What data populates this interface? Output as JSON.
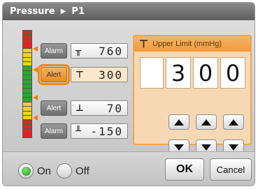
{
  "titlebar": {
    "title": "Pressure",
    "separator_icon": "triangle-right-icon",
    "channel": "P1"
  },
  "level_bar": {
    "segments": [
      "#d42b1e",
      "#d42b1e",
      "#d42b1e",
      "#d42b1e",
      "#f0d21a",
      "#f0d21a",
      "#f0d21a",
      "#f0d21a",
      "#2da831",
      "#2da831",
      "#2da831",
      "#2da831",
      "#2da831",
      "#2da831",
      "#2da831",
      "#2da831",
      "#f0d21a",
      "#f0d21a",
      "#f0d21a",
      "#f0d21a",
      "#d42b1e",
      "#d42b1e",
      "#d42b1e",
      "#d42b1e"
    ],
    "marker_color": "#ff7a00"
  },
  "limits": [
    {
      "button_label": "Alarm",
      "icon": "upper-upper-limit-icon",
      "icon_glyph": "╥",
      "value": "760",
      "selected": false
    },
    {
      "button_label": "Alert",
      "icon": "upper-limit-icon",
      "icon_glyph": "⊤",
      "value": "300",
      "selected": true
    },
    {
      "button_label": "Alert",
      "icon": "lower-limit-icon",
      "icon_glyph": "⊥",
      "value": "70",
      "selected": false
    },
    {
      "button_label": "Alarm",
      "icon": "lower-lower-limit-icon",
      "icon_glyph": "╨",
      "value": "-150",
      "selected": false
    }
  ],
  "editor": {
    "icon_glyph": "⊤",
    "header_label": "Upper Limit (mmHg)",
    "digits": [
      "3",
      "0",
      "0"
    ]
  },
  "footer": {
    "on_label": "On",
    "off_label": "Off",
    "selected": "On",
    "ok_label": "OK",
    "cancel_label": "Cancel"
  },
  "colors": {
    "accent": "#f09a3c",
    "selection_outline": "#f08a1c",
    "on_indicator": "#1f9a1a"
  }
}
